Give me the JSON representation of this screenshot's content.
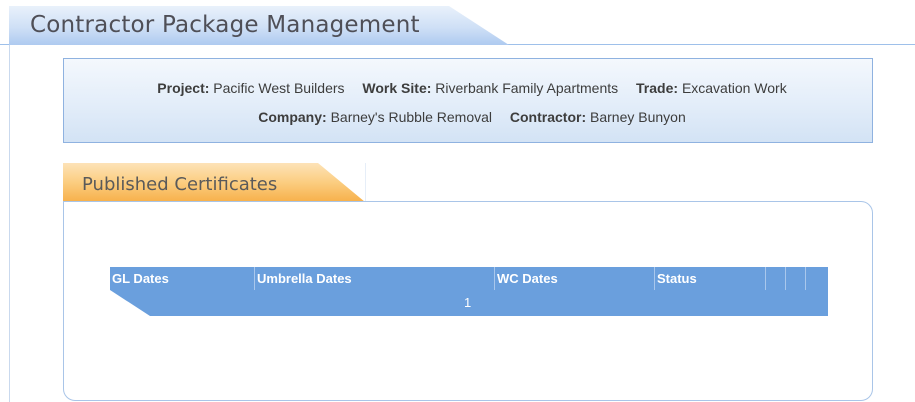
{
  "page": {
    "title": "Contractor Package Management"
  },
  "info": {
    "project_label": "Project:",
    "project_value": "Pacific West Builders",
    "worksite_label": "Work Site:",
    "worksite_value": "Riverbank Family Apartments",
    "trade_label": "Trade:",
    "trade_value": "Excavation Work",
    "company_label": "Company:",
    "company_value": "Barney's Rubble Removal",
    "contractor_label": "Contractor:",
    "contractor_value": "Barney Bunyon"
  },
  "certificates": {
    "tab_title": "Published Certificates",
    "columns": [
      "GL Dates",
      "Umbrella Dates",
      "WC Dates",
      "Status",
      "",
      "",
      ""
    ],
    "rows": [],
    "pager": {
      "current_page": "1"
    }
  },
  "colors": {
    "header_blue": "#aecaf0",
    "tab_orange": "#f7b04a",
    "grid_blue": "#6a9fdd",
    "panel_border": "#8fb2e0"
  }
}
